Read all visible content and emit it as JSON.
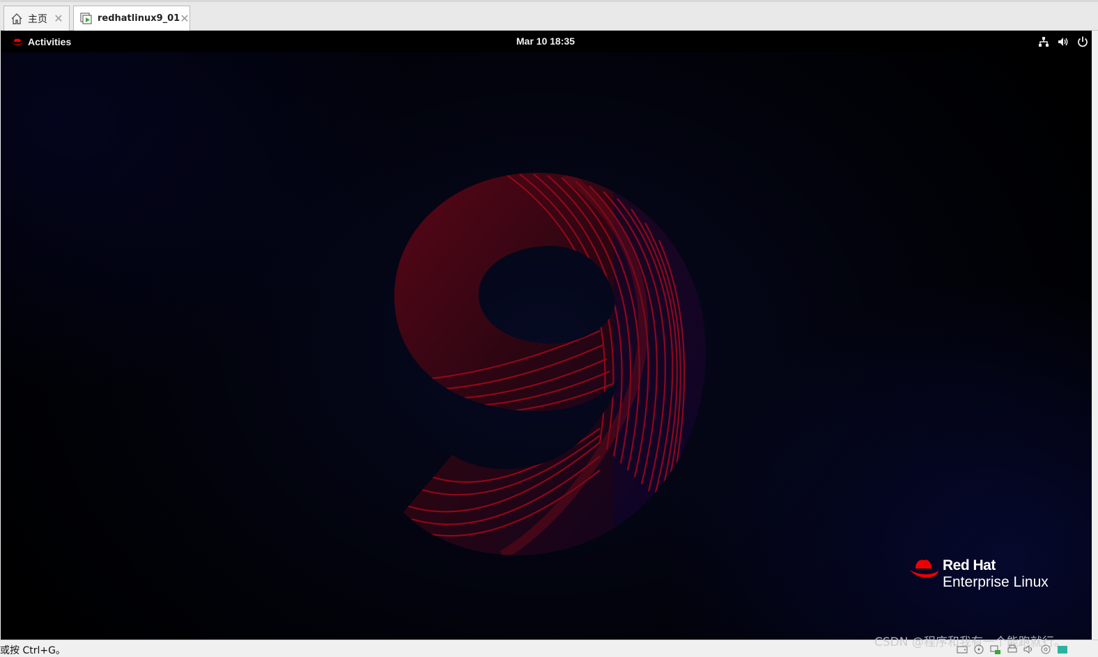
{
  "tabs": [
    {
      "label": "主页",
      "icon": "home-icon"
    },
    {
      "label": "redhatlinux9_01",
      "icon": "vm-running-icon"
    }
  ],
  "gnome": {
    "activities_label": "Activities",
    "clock": "Mar 10  18:35",
    "tray_icons": [
      "network-icon",
      "volume-icon",
      "power-icon"
    ]
  },
  "wallpaper": {
    "logo_line1": "Red Hat",
    "logo_line2": "Enterprise Linux",
    "colors": {
      "accent_red": "#cc0000",
      "bg_dark": "#02030c",
      "bg_blue": "#0a0e50"
    }
  },
  "statusbar": {
    "hint": "或按 Ctrl+G。",
    "watermark": "CSDN @程序和我有一个能跑就行。",
    "device_icons": [
      "hdd-icon",
      "cdrom-icon",
      "network-adapter-icon",
      "printer-icon",
      "sound-icon",
      "usb-icon",
      "display-icon"
    ]
  }
}
